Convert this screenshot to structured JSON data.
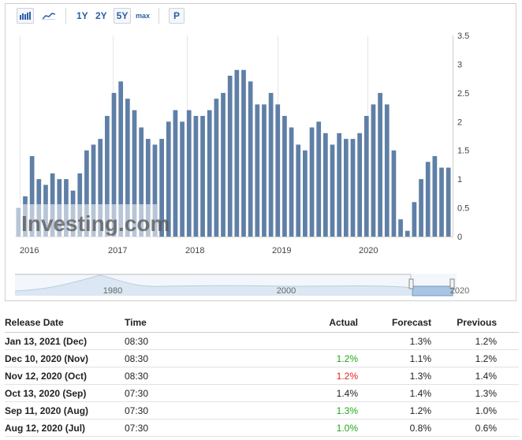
{
  "toolbar": {
    "ranges": [
      "1Y",
      "2Y",
      "5Y",
      "max"
    ],
    "active_range": "5Y",
    "p_label": "P"
  },
  "watermark": "Investing.com",
  "chart_data": {
    "type": "bar",
    "ylim": [
      0,
      3.5
    ],
    "yticks": [
      0,
      0.5,
      1,
      1.5,
      2,
      2.5,
      3,
      3.5
    ],
    "ytick_labels": [
      "0",
      "0.5",
      "1",
      "1.5",
      "2",
      "2.5",
      "3",
      "3.5"
    ],
    "xtick_labels": [
      "2016",
      "2017",
      "2018",
      "2019",
      "2020"
    ],
    "values": [
      0.5,
      0.7,
      1.4,
      1.0,
      0.9,
      1.1,
      1.0,
      1.0,
      0.8,
      1.1,
      1.5,
      1.6,
      1.7,
      2.1,
      2.5,
      2.7,
      2.4,
      2.2,
      1.9,
      1.7,
      1.6,
      1.7,
      2.0,
      2.2,
      2.0,
      2.2,
      2.1,
      2.1,
      2.2,
      2.4,
      2.5,
      2.8,
      2.9,
      2.9,
      2.7,
      2.3,
      2.3,
      2.5,
      2.3,
      2.1,
      1.9,
      1.6,
      1.5,
      1.9,
      2.0,
      1.8,
      1.6,
      1.8,
      1.7,
      1.7,
      1.8,
      2.1,
      2.3,
      2.5,
      2.3,
      1.5,
      0.3,
      0.1,
      0.6,
      1.0,
      1.3,
      1.4,
      1.2,
      1.2
    ],
    "navigator_labels": [
      "1980",
      "2000",
      "2020"
    ]
  },
  "table": {
    "headers": [
      "Release Date",
      "Time",
      "Actual",
      "Forecast",
      "Previous"
    ],
    "rows": [
      {
        "date": "Jan 13, 2021 (Dec)",
        "time": "08:30",
        "actual": "",
        "actual_color": "",
        "forecast": "1.3%",
        "previous": "1.2%"
      },
      {
        "date": "Dec 10, 2020 (Nov)",
        "time": "08:30",
        "actual": "1.2%",
        "actual_color": "#22a51c",
        "forecast": "1.1%",
        "previous": "1.2%"
      },
      {
        "date": "Nov 12, 2020 (Oct)",
        "time": "08:30",
        "actual": "1.2%",
        "actual_color": "#e0241b",
        "forecast": "1.3%",
        "previous": "1.4%"
      },
      {
        "date": "Oct 13, 2020 (Sep)",
        "time": "07:30",
        "actual": "1.4%",
        "actual_color": "#222222",
        "forecast": "1.4%",
        "previous": "1.3%"
      },
      {
        "date": "Sep 11, 2020 (Aug)",
        "time": "07:30",
        "actual": "1.3%",
        "actual_color": "#22a51c",
        "forecast": "1.2%",
        "previous": "1.0%"
      },
      {
        "date": "Aug 12, 2020 (Jul)",
        "time": "07:30",
        "actual": "1.0%",
        "actual_color": "#22a51c",
        "forecast": "0.8%",
        "previous": "0.6%"
      }
    ]
  }
}
